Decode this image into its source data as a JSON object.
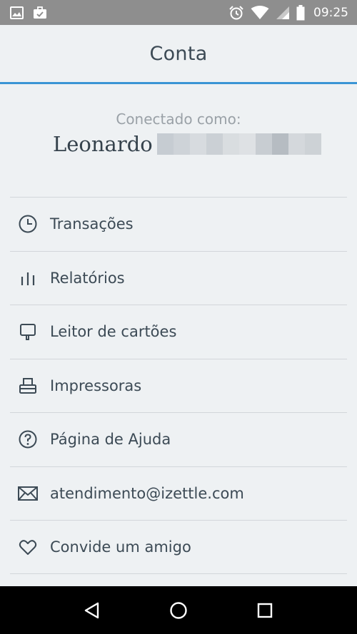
{
  "status_bar": {
    "time": "09:25",
    "left_icons": [
      "image-icon",
      "briefcase-icon"
    ],
    "right_icons": [
      "alarm-icon",
      "wifi-icon",
      "signal-icon",
      "battery-icon"
    ]
  },
  "header": {
    "title": "Conta"
  },
  "account": {
    "connected_label": "Conectado como:",
    "user_name": "Leonardo"
  },
  "menu": {
    "items": [
      {
        "label": "Transações",
        "icon": "clock-icon"
      },
      {
        "label": "Relatórios",
        "icon": "bars-icon"
      },
      {
        "label": "Leitor de cartões",
        "icon": "card-reader-icon"
      },
      {
        "label": "Impressoras",
        "icon": "printer-icon"
      },
      {
        "label": "Página de Ajuda",
        "icon": "help-icon"
      },
      {
        "label": "atendimento@izettle.com",
        "icon": "mail-icon"
      },
      {
        "label": "Convide um amigo",
        "icon": "heart-icon"
      }
    ]
  },
  "nav": {
    "buttons": [
      "back-icon",
      "home-icon",
      "recents-icon"
    ]
  },
  "colors": {
    "accent": "#3a95d5",
    "text": "#3c4a55",
    "muted": "#9aa1a7",
    "background": "#eef1f3"
  }
}
